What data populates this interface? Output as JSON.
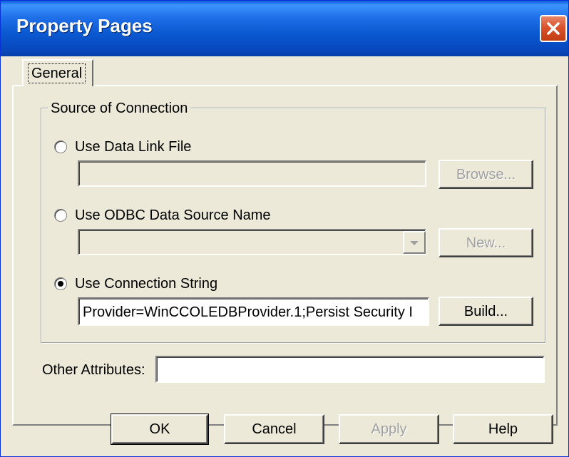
{
  "window": {
    "title": "Property Pages"
  },
  "tabs": [
    {
      "label": "General"
    }
  ],
  "group": {
    "title": "Source of Connection",
    "options": [
      {
        "label": "Use Data Link File",
        "selected": false,
        "field_value": "",
        "button_label": "Browse...",
        "button_enabled": false
      },
      {
        "label": "Use ODBC Data Source Name",
        "selected": false,
        "field_value": "",
        "button_label": "New...",
        "button_enabled": false
      },
      {
        "label": "Use Connection String",
        "selected": true,
        "field_value": "Provider=WinCCOLEDBProvider.1;Persist Security I",
        "button_label": "Build...",
        "button_enabled": true
      }
    ]
  },
  "other_attributes": {
    "label": "Other Attributes:",
    "value": ""
  },
  "buttons": {
    "ok": "OK",
    "cancel": "Cancel",
    "apply": "Apply",
    "help": "Help"
  },
  "colors": {
    "titlebar": "#0a58d0",
    "face": "#ece9d8",
    "close": "#d9532c"
  }
}
